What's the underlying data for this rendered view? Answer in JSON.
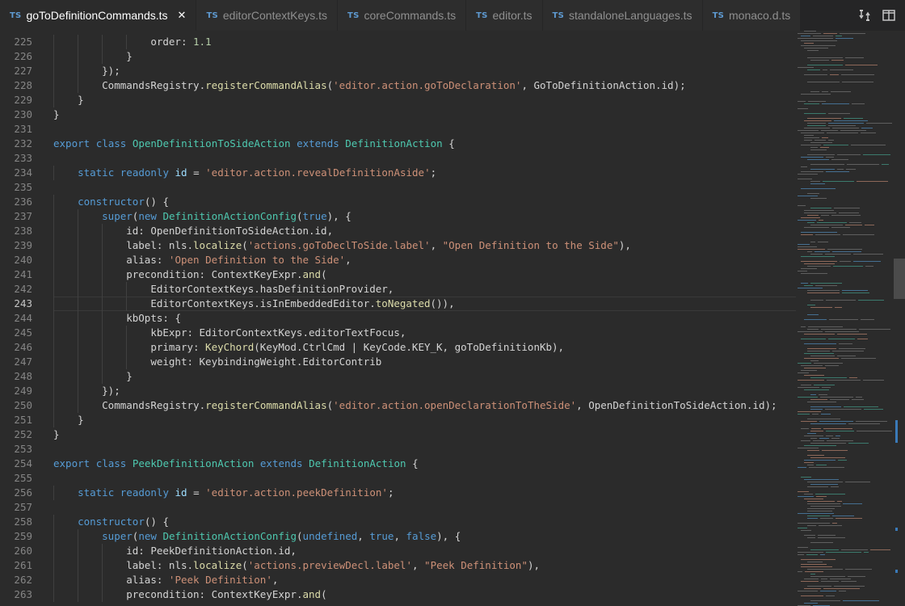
{
  "tabs": [
    {
      "lang": "TS",
      "name": "goToDefinitionCommands.ts",
      "active": true,
      "close": "✕"
    },
    {
      "lang": "TS",
      "name": "editorContextKeys.ts"
    },
    {
      "lang": "TS",
      "name": "coreCommands.ts"
    },
    {
      "lang": "TS",
      "name": "editor.ts"
    },
    {
      "lang": "TS",
      "name": "standaloneLanguages.ts"
    },
    {
      "lang": "TS",
      "name": "monaco.d.ts"
    }
  ],
  "actions": {
    "compare_icon": "compare-changes-icon",
    "split_icon": "split-editor-icon"
  },
  "current_line": 243,
  "lines": [
    {
      "n": 225,
      "indent": 5,
      "tokens": [
        [
          "p",
          "order: "
        ],
        [
          "n",
          "1.1"
        ]
      ]
    },
    {
      "n": 226,
      "indent": 4,
      "tokens": [
        [
          "p",
          "}"
        ]
      ]
    },
    {
      "n": 227,
      "indent": 3,
      "tokens": [
        [
          "p",
          "});"
        ]
      ]
    },
    {
      "n": 228,
      "indent": 3,
      "tokens": [
        [
          "p",
          "CommandsRegistry."
        ],
        [
          "f",
          "registerCommandAlias"
        ],
        [
          "p",
          "("
        ],
        [
          "s",
          "'editor.action.goToDeclaration'"
        ],
        [
          "p",
          ", GoToDefinitionAction.id);"
        ]
      ]
    },
    {
      "n": 229,
      "indent": 2,
      "tokens": [
        [
          "p",
          "}"
        ]
      ]
    },
    {
      "n": 230,
      "indent": 1,
      "tokens": [
        [
          "p",
          "}"
        ]
      ]
    },
    {
      "n": 231,
      "indent": 1,
      "tokens": []
    },
    {
      "n": 232,
      "indent": 1,
      "tokens": [
        [
          "k",
          "export"
        ],
        [
          "p",
          " "
        ],
        [
          "k",
          "class"
        ],
        [
          "p",
          " "
        ],
        [
          "t",
          "OpenDefinitionToSideAction"
        ],
        [
          "p",
          " "
        ],
        [
          "k",
          "extends"
        ],
        [
          "p",
          " "
        ],
        [
          "t",
          "DefinitionAction"
        ],
        [
          "p",
          " {"
        ]
      ]
    },
    {
      "n": 233,
      "indent": 1,
      "tokens": []
    },
    {
      "n": 234,
      "indent": 2,
      "tokens": [
        [
          "k",
          "static"
        ],
        [
          "p",
          " "
        ],
        [
          "k",
          "readonly"
        ],
        [
          "p",
          " "
        ],
        [
          "v",
          "id"
        ],
        [
          "p",
          " = "
        ],
        [
          "s",
          "'editor.action.revealDefinitionAside'"
        ],
        [
          "p",
          ";"
        ]
      ]
    },
    {
      "n": 235,
      "indent": 1,
      "tokens": []
    },
    {
      "n": 236,
      "indent": 2,
      "tokens": [
        [
          "k",
          "constructor"
        ],
        [
          "p",
          "() {"
        ]
      ]
    },
    {
      "n": 237,
      "indent": 3,
      "tokens": [
        [
          "k",
          "super"
        ],
        [
          "p",
          "("
        ],
        [
          "k",
          "new"
        ],
        [
          "p",
          " "
        ],
        [
          "t",
          "DefinitionActionConfig"
        ],
        [
          "p",
          "("
        ],
        [
          "k",
          "true"
        ],
        [
          "p",
          "), {"
        ]
      ]
    },
    {
      "n": 238,
      "indent": 4,
      "tokens": [
        [
          "p",
          "id: OpenDefinitionToSideAction.id,"
        ]
      ]
    },
    {
      "n": 239,
      "indent": 4,
      "tokens": [
        [
          "p",
          "label: nls."
        ],
        [
          "f",
          "localize"
        ],
        [
          "p",
          "("
        ],
        [
          "s",
          "'actions.goToDeclToSide.label'"
        ],
        [
          "p",
          ", "
        ],
        [
          "s",
          "\"Open Definition to the Side\""
        ],
        [
          "p",
          "),"
        ]
      ]
    },
    {
      "n": 240,
      "indent": 4,
      "tokens": [
        [
          "p",
          "alias: "
        ],
        [
          "s",
          "'Open Definition to the Side'"
        ],
        [
          "p",
          ","
        ]
      ]
    },
    {
      "n": 241,
      "indent": 4,
      "tokens": [
        [
          "p",
          "precondition: ContextKeyExpr."
        ],
        [
          "f",
          "and"
        ],
        [
          "p",
          "("
        ]
      ]
    },
    {
      "n": 242,
      "indent": 5,
      "tokens": [
        [
          "p",
          "EditorContextKeys.hasDefinitionProvider,"
        ]
      ]
    },
    {
      "n": 243,
      "indent": 5,
      "tokens": [
        [
          "p",
          "EditorContextKeys.isInEmbeddedEditor."
        ],
        [
          "f",
          "toNegated"
        ],
        [
          "p",
          "()),"
        ]
      ]
    },
    {
      "n": 244,
      "indent": 4,
      "tokens": [
        [
          "p",
          "kbOpts: {"
        ]
      ]
    },
    {
      "n": 245,
      "indent": 5,
      "tokens": [
        [
          "p",
          "kbExpr: EditorContextKeys.editorTextFocus,"
        ]
      ]
    },
    {
      "n": 246,
      "indent": 5,
      "tokens": [
        [
          "p",
          "primary: "
        ],
        [
          "f",
          "KeyChord"
        ],
        [
          "p",
          "(KeyMod.CtrlCmd | KeyCode.KEY_K, goToDefinitionKb),"
        ]
      ]
    },
    {
      "n": 247,
      "indent": 5,
      "tokens": [
        [
          "p",
          "weight: KeybindingWeight.EditorContrib"
        ]
      ]
    },
    {
      "n": 248,
      "indent": 4,
      "tokens": [
        [
          "p",
          "}"
        ]
      ]
    },
    {
      "n": 249,
      "indent": 3,
      "tokens": [
        [
          "p",
          "});"
        ]
      ]
    },
    {
      "n": 250,
      "indent": 3,
      "tokens": [
        [
          "p",
          "CommandsRegistry."
        ],
        [
          "f",
          "registerCommandAlias"
        ],
        [
          "p",
          "("
        ],
        [
          "s",
          "'editor.action.openDeclarationToTheSide'"
        ],
        [
          "p",
          ", OpenDefinitionToSideAction.id);"
        ]
      ]
    },
    {
      "n": 251,
      "indent": 2,
      "tokens": [
        [
          "p",
          "}"
        ]
      ]
    },
    {
      "n": 252,
      "indent": 1,
      "tokens": [
        [
          "p",
          "}"
        ]
      ]
    },
    {
      "n": 253,
      "indent": 1,
      "tokens": []
    },
    {
      "n": 254,
      "indent": 1,
      "tokens": [
        [
          "k",
          "export"
        ],
        [
          "p",
          " "
        ],
        [
          "k",
          "class"
        ],
        [
          "p",
          " "
        ],
        [
          "t",
          "PeekDefinitionAction"
        ],
        [
          "p",
          " "
        ],
        [
          "k",
          "extends"
        ],
        [
          "p",
          " "
        ],
        [
          "t",
          "DefinitionAction"
        ],
        [
          "p",
          " {"
        ]
      ]
    },
    {
      "n": 255,
      "indent": 1,
      "tokens": []
    },
    {
      "n": 256,
      "indent": 2,
      "tokens": [
        [
          "k",
          "static"
        ],
        [
          "p",
          " "
        ],
        [
          "k",
          "readonly"
        ],
        [
          "p",
          " "
        ],
        [
          "v",
          "id"
        ],
        [
          "p",
          " = "
        ],
        [
          "s",
          "'editor.action.peekDefinition'"
        ],
        [
          "p",
          ";"
        ]
      ]
    },
    {
      "n": 257,
      "indent": 1,
      "tokens": []
    },
    {
      "n": 258,
      "indent": 2,
      "tokens": [
        [
          "k",
          "constructor"
        ],
        [
          "p",
          "() {"
        ]
      ]
    },
    {
      "n": 259,
      "indent": 3,
      "tokens": [
        [
          "k",
          "super"
        ],
        [
          "p",
          "("
        ],
        [
          "k",
          "new"
        ],
        [
          "p",
          " "
        ],
        [
          "t",
          "DefinitionActionConfig"
        ],
        [
          "p",
          "("
        ],
        [
          "k",
          "undefined"
        ],
        [
          "p",
          ", "
        ],
        [
          "k",
          "true"
        ],
        [
          "p",
          ", "
        ],
        [
          "k",
          "false"
        ],
        [
          "p",
          "), {"
        ]
      ]
    },
    {
      "n": 260,
      "indent": 4,
      "tokens": [
        [
          "p",
          "id: PeekDefinitionAction.id,"
        ]
      ]
    },
    {
      "n": 261,
      "indent": 4,
      "tokens": [
        [
          "p",
          "label: nls."
        ],
        [
          "f",
          "localize"
        ],
        [
          "p",
          "("
        ],
        [
          "s",
          "'actions.previewDecl.label'"
        ],
        [
          "p",
          ", "
        ],
        [
          "s",
          "\"Peek Definition\""
        ],
        [
          "p",
          "),"
        ]
      ]
    },
    {
      "n": 262,
      "indent": 4,
      "tokens": [
        [
          "p",
          "alias: "
        ],
        [
          "s",
          "'Peek Definition'"
        ],
        [
          "p",
          ","
        ]
      ]
    },
    {
      "n": 263,
      "indent": 4,
      "tokens": [
        [
          "p",
          "precondition: ContextKeyExpr."
        ],
        [
          "f",
          "and"
        ],
        [
          "p",
          "("
        ]
      ]
    }
  ]
}
